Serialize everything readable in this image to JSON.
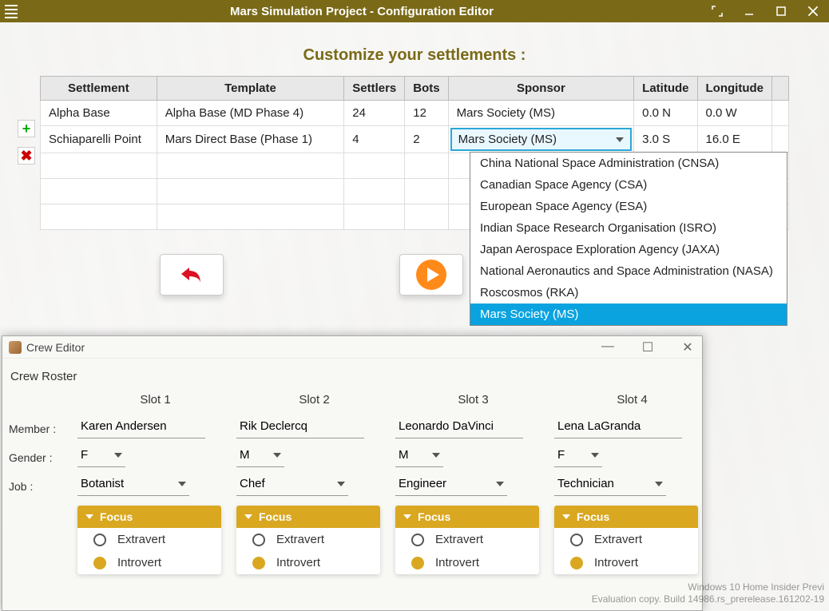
{
  "window": {
    "title": "Mars Simulation Project - Configuration Editor",
    "section_title": "Customize your settlements :"
  },
  "columns": {
    "c0": "Settlement",
    "c1": "Template",
    "c2": "Settlers",
    "c3": "Bots",
    "c4": "Sponsor",
    "c5": "Latitude",
    "c6": "Longitude"
  },
  "rows": [
    {
      "settlement": "Alpha Base",
      "template": "Alpha Base (MD Phase 4)",
      "settlers": "24",
      "bots": "12",
      "sponsor": "Mars Society (MS)",
      "lat": "0.0 N",
      "lon": "0.0 W"
    },
    {
      "settlement": "Schiaparelli Point",
      "template": "Mars Direct Base (Phase 1)",
      "settlers": "4",
      "bots": "2",
      "sponsor": "Mars Society (MS)",
      "lat": "3.0 S",
      "lon": "16.0 E"
    }
  ],
  "sponsor_options": {
    "o0": "China National Space Administration (CNSA)",
    "o1": "Canadian Space Agency (CSA)",
    "o2": "European Space Agency (ESA)",
    "o3": "Indian Space Research Organisation (ISRO)",
    "o4": "Japan Aerospace Exploration Agency (JAXA)",
    "o5": "National Aeronautics and Space Administration (NASA)",
    "o6": "Roscosmos (RKA)",
    "o7": "Mars Society (MS)"
  },
  "sponsor_selected": "Mars Society (MS)",
  "crew": {
    "title": "Crew Editor",
    "roster_label": "Crew Roster",
    "labels": {
      "member": "Member :",
      "gender": "Gender :",
      "job": "Job :"
    },
    "slots": {
      "s1": {
        "hdr": "Slot 1",
        "member": "Karen Andersen",
        "gender": "F",
        "job": "Botanist"
      },
      "s2": {
        "hdr": "Slot 2",
        "member": "Rik Declercq",
        "gender": "M",
        "job": "Chef"
      },
      "s3": {
        "hdr": "Slot 3",
        "member": "Leonardo DaVinci",
        "gender": "M",
        "job": "Engineer"
      },
      "s4": {
        "hdr": "Slot 4",
        "member": "Lena LaGranda",
        "gender": "F",
        "job": "Technician"
      }
    },
    "focus": {
      "hdr": "Focus",
      "opt1": "Extravert",
      "opt2": "Introvert"
    }
  },
  "watermark": {
    "l1": "Windows 10 Home Insider Previ",
    "l2": "Evaluation copy. Build 14986.rs_prerelease.161202-19"
  }
}
